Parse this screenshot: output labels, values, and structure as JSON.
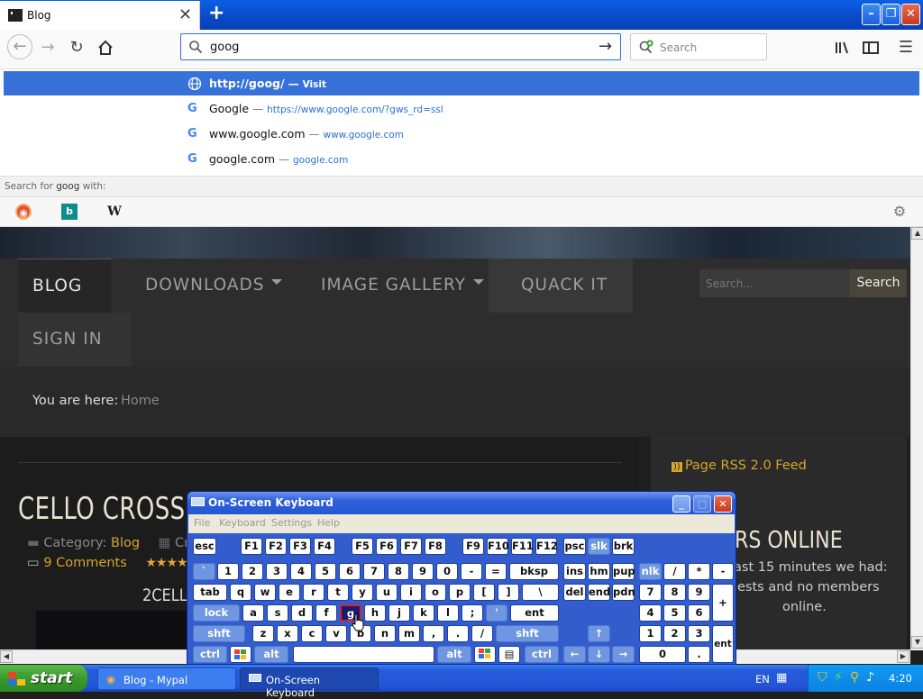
{
  "browser": {
    "tab_title": "Blog",
    "new_tab_symbol": "+",
    "url_value": "goog",
    "search_placeholder": "Search"
  },
  "dropdown": {
    "rows": [
      {
        "t1": "http://goog/",
        "sep": "—",
        "t2": "Visit"
      },
      {
        "t1": "Google",
        "sep": "—",
        "t2": "https://www.google.com/?gws_rd=ssl"
      },
      {
        "t1": "www.google.com",
        "sep": "—",
        "t2": "www.google.com"
      },
      {
        "t1": "google.com",
        "sep": "—",
        "t2": "google.com"
      }
    ],
    "search_for_prefix": "Search for",
    "search_for_term": "goog",
    "search_for_suffix": "with:",
    "engines": [
      "duckduckgo-icon",
      "bing-icon",
      "wikipedia-icon"
    ],
    "wikipedia_letter": "W"
  },
  "site": {
    "menu": [
      {
        "label": "BLOG"
      },
      {
        "label": "DOWNLOADS"
      },
      {
        "label": "IMAGE GALLERY"
      },
      {
        "label": "QUACK IT"
      },
      {
        "label": "SIGN IN"
      }
    ],
    "search_placeholder": "Search...",
    "search_button": "Search",
    "breadcrumb_label": "You are here:",
    "breadcrumb_home": "Home",
    "article_title": "CELLO CROSSO",
    "category_label": "Category:",
    "category_value": "Blog",
    "category_trailing": "Cr",
    "comments": "9 Comments",
    "subhead": "2CELL",
    "rss": "Page RSS 2.0 Feed",
    "online_title": "RS ONLINE",
    "online_line1": "ast 15 minutes we had:",
    "online_line2": "ests and no members",
    "online_line3": "online."
  },
  "osk": {
    "title": "On-Screen Keyboard",
    "menu": [
      "File",
      "Keyboard",
      "Settings",
      "Help"
    ],
    "row0": [
      "esc",
      "F1",
      "F2",
      "F3",
      "F4",
      "F5",
      "F6",
      "F7",
      "F8",
      "F9",
      "F10",
      "F11",
      "F12",
      "psc",
      "slk",
      "brk"
    ],
    "row1": [
      "`",
      "1",
      "2",
      "3",
      "4",
      "5",
      "6",
      "7",
      "8",
      "9",
      "0",
      "-",
      "=",
      "bksp",
      "ins",
      "hm",
      "pup",
      "nlk",
      "/",
      "*",
      "-"
    ],
    "row2": [
      "tab",
      "q",
      "w",
      "e",
      "r",
      "t",
      "y",
      "u",
      "i",
      "o",
      "p",
      "[",
      "]",
      "\\",
      "del",
      "end",
      "pdn",
      "7",
      "8",
      "9",
      "+"
    ],
    "row3": [
      "lock",
      "a",
      "s",
      "d",
      "f",
      "g",
      "h",
      "j",
      "k",
      "l",
      ";",
      "'",
      "ent",
      "4",
      "5",
      "6"
    ],
    "row4": [
      "shft",
      "z",
      "x",
      "c",
      "v",
      "b",
      "n",
      "m",
      ",",
      ".",
      "/",
      "shft",
      "↑",
      "1",
      "2",
      "3",
      "ent"
    ],
    "row5": [
      "ctrl",
      "alt",
      "alt",
      "ctrl",
      "←",
      "↓",
      "→",
      "0",
      "."
    ]
  },
  "taskbar": {
    "start": "start",
    "items": [
      "Blog - Mypal",
      "On-Screen Keyboard"
    ],
    "language": "EN",
    "clock": "4:20"
  }
}
